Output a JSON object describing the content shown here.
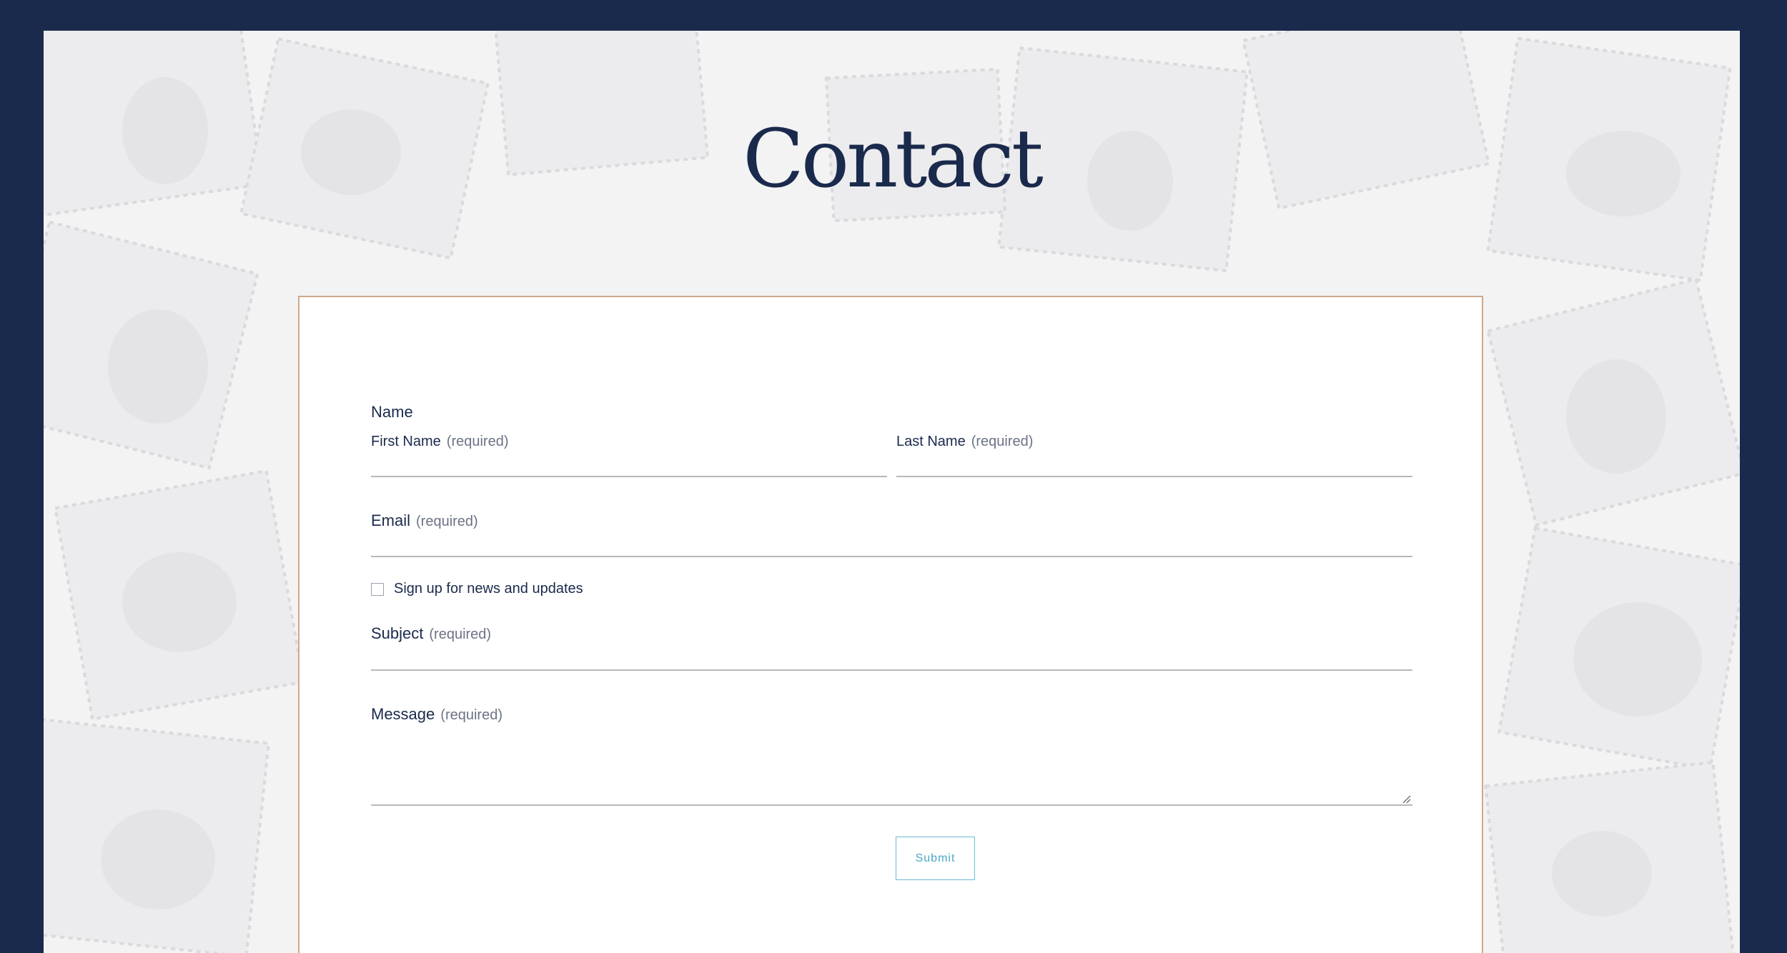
{
  "page": {
    "title": "Contact"
  },
  "form": {
    "name": {
      "label": "Name",
      "first_name_label": "First Name",
      "first_name_required": "(required)",
      "first_name_value": "",
      "last_name_label": "Last Name",
      "last_name_required": "(required)",
      "last_name_value": ""
    },
    "email": {
      "label": "Email",
      "required": "(required)",
      "value": ""
    },
    "newsletter": {
      "label": "Sign up for news and updates",
      "checked": false
    },
    "subject": {
      "label": "Subject",
      "required": "(required)",
      "value": ""
    },
    "message": {
      "label": "Message",
      "required": "(required)",
      "value": ""
    },
    "submit_label": "Submit"
  },
  "colors": {
    "frame": "#1a2a4c",
    "title": "#1a2a4c",
    "card_border": "#cfa98a",
    "submit_accent": "#4aa7c9",
    "required_text": "#6c7386"
  },
  "icons": {
    "textarea_resize": "resize-handle-icon",
    "background": "stamps-collage-image"
  }
}
